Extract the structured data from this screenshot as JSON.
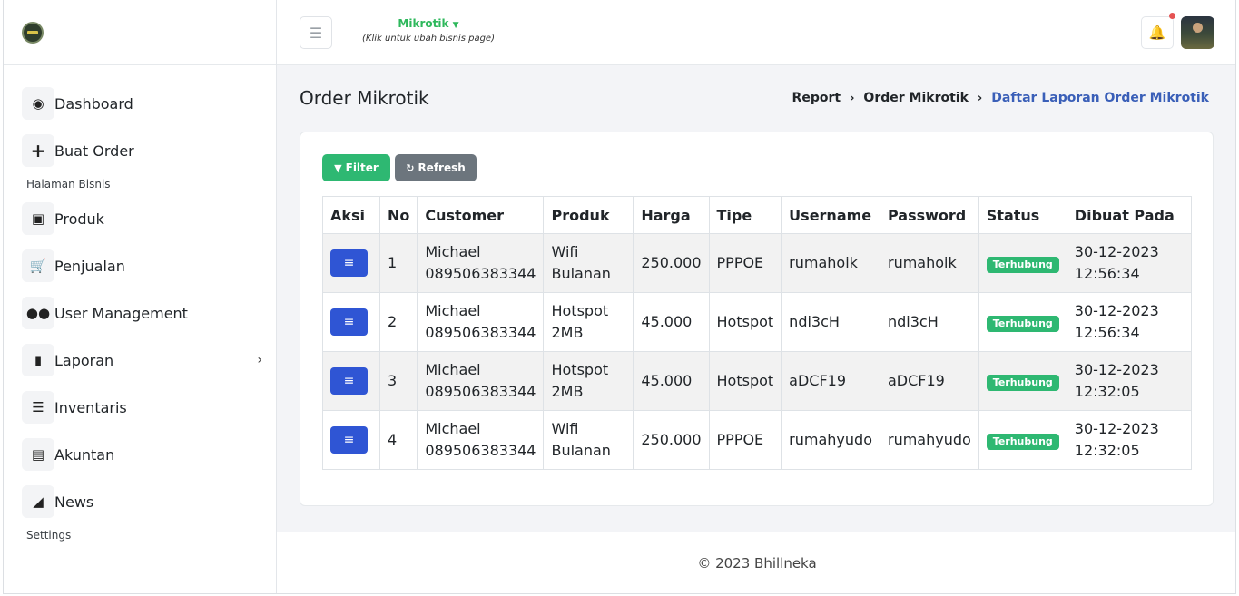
{
  "header": {
    "business_name": "Mikrotik",
    "business_hint": "(Klik untuk ubah bisnis page)"
  },
  "sidebar": {
    "items": [
      {
        "label": "Dashboard",
        "icon": "gauge-icon"
      },
      {
        "label": "Buat Order",
        "icon": "plus-icon"
      },
      {
        "label": "Produk",
        "icon": "box-icon"
      },
      {
        "label": "Penjualan",
        "icon": "cart-icon"
      },
      {
        "label": "User Management",
        "icon": "users-icon"
      },
      {
        "label": "Laporan",
        "icon": "file-icon"
      },
      {
        "label": "Inventaris",
        "icon": "list-icon"
      },
      {
        "label": "Akuntan",
        "icon": "money-icon"
      },
      {
        "label": "News",
        "icon": "megaphone-icon"
      }
    ],
    "section_bisnis": "Halaman Bisnis",
    "section_settings": "Settings"
  },
  "page": {
    "title": "Order Mikrotik",
    "breadcrumb": [
      "Report",
      "Order Mikrotik",
      "Daftar Laporan Order Mikrotik"
    ]
  },
  "toolbar": {
    "filter_label": "Filter",
    "refresh_label": "Refresh"
  },
  "table": {
    "columns": [
      "Aksi",
      "No",
      "Customer",
      "Produk",
      "Harga",
      "Tipe",
      "Username",
      "Password",
      "Status",
      "Dibuat Pada"
    ],
    "rows": [
      {
        "no": "1",
        "customer_name": "Michael",
        "customer_phone": "089506383344",
        "produk_line1": "Wifi",
        "produk_line2": "Bulanan",
        "harga": "250.000",
        "tipe": "PPPOE",
        "username": "rumahoik",
        "password": "rumahoik",
        "status": "Terhubung",
        "date": "30-12-2023",
        "time": "12:56:34"
      },
      {
        "no": "2",
        "customer_name": "Michael",
        "customer_phone": "089506383344",
        "produk_line1": "Hotspot",
        "produk_line2": "2MB",
        "harga": "45.000",
        "tipe": "Hotspot",
        "username": "ndi3cH",
        "password": "ndi3cH",
        "status": "Terhubung",
        "date": "30-12-2023",
        "time": "12:56:34"
      },
      {
        "no": "3",
        "customer_name": "Michael",
        "customer_phone": "089506383344",
        "produk_line1": "Hotspot",
        "produk_line2": "2MB",
        "harga": "45.000",
        "tipe": "Hotspot",
        "username": "aDCF19",
        "password": "aDCF19",
        "status": "Terhubung",
        "date": "30-12-2023",
        "time": "12:32:05"
      },
      {
        "no": "4",
        "customer_name": "Michael",
        "customer_phone": "089506383344",
        "produk_line1": "Wifi",
        "produk_line2": "Bulanan",
        "harga": "250.000",
        "tipe": "PPPOE",
        "username": "rumahyudo",
        "password": "rumahyudo",
        "status": "Terhubung",
        "date": "30-12-2023",
        "time": "12:32:05"
      }
    ]
  },
  "footer": {
    "text": "© 2023 Bhillneka"
  },
  "colors": {
    "accent_green": "#2eb872",
    "action_blue": "#2f55d4",
    "breadcrumb_active": "#3a5fb8",
    "notification_dot": "#e55353"
  }
}
